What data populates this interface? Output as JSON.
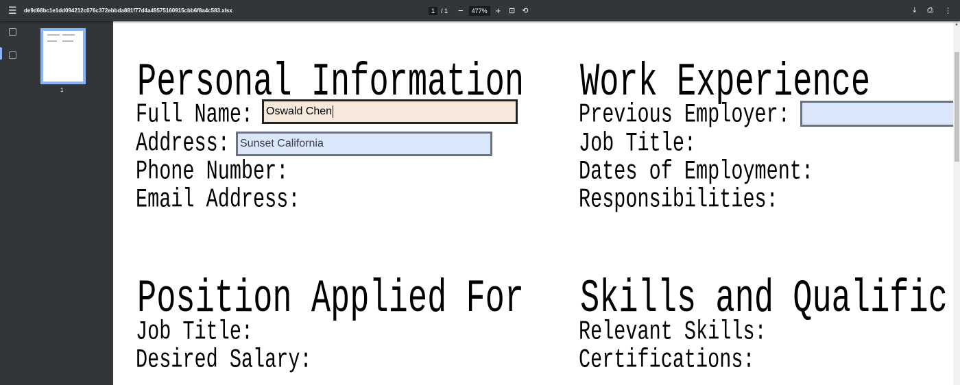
{
  "toolbar": {
    "filename": "de9d68bc1e1dd094212c076c372ebbda881f77d4a49575160915cbb6f8a4c583.xlsx",
    "page_current": "1",
    "page_total": "/ 1",
    "zoom": "477%",
    "zoom_out": "−",
    "zoom_in": "+",
    "menu_icon": "☰",
    "fit_icon": "⊡",
    "rotate_icon": "⟲",
    "download_icon": "⤓",
    "print_icon": "⎙",
    "more_icon": "⋮"
  },
  "sidebar": {
    "thumbnail_label": "1"
  },
  "document": {
    "personal": {
      "heading": "Personal Information",
      "full_name_label": "Full Name:",
      "full_name_value": "Oswald Chen",
      "address_label": "Address:",
      "address_value": "Sunset California",
      "phone_label": "Phone Number:",
      "email_label": "Email Address:"
    },
    "work": {
      "heading": "Work Experience",
      "employer_label": "Previous Employer:",
      "employer_value": "",
      "job_title_label": "Job Title:",
      "dates_label": "Dates of Employment:",
      "resp_label": "Responsibilities:"
    },
    "position": {
      "heading": "Position Applied For",
      "job_title_label": "Job Title:",
      "salary_label": "Desired Salary:"
    },
    "skills": {
      "heading": "Skills and Qualific",
      "skills_label": "Relevant Skills:",
      "cert_label": "Certifications:"
    }
  }
}
